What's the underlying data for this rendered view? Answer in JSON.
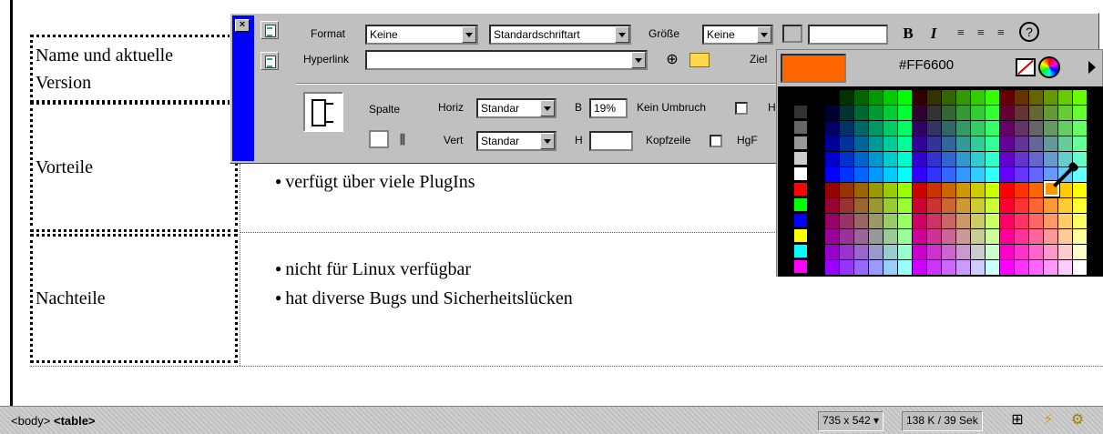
{
  "document": {
    "cells": [
      {
        "label_line1": "Name und aktuelle",
        "label_line2": "Version"
      },
      {
        "label": "Vorteile"
      },
      {
        "label": "Nachteile"
      }
    ],
    "bullets_vorteile": [
      "verfügt über viele PlugIns"
    ],
    "bullets_nachteile": [
      "nicht für Linux verfügbar",
      "hat diverse Bugs und Sicherheitslücken"
    ]
  },
  "inspector": {
    "close_label": "×",
    "format_label": "Format",
    "format_value": "Keine",
    "font_value": "Standardschriftart",
    "size_label": "Größe",
    "size_value": "Keine",
    "bold_label": "B",
    "italic_label": "I",
    "help_label": "?",
    "hyperlink_label": "Hyperlink",
    "hyperlink_value": "",
    "target_label": "Ziel",
    "column_label": "Spalte",
    "horiz_label": "Horiz",
    "horiz_value": "Standar",
    "vert_label": "Vert",
    "vert_value": "Standar",
    "width_label": "B",
    "width_value": "19%",
    "height_label": "H",
    "height_value": "",
    "nowrap_label": "Kein Umbruch",
    "header_label": "Kopfzeile",
    "bg_label": "HgF",
    "h_cut_label": "H"
  },
  "color_picker": {
    "current_hex": "#FF6600",
    "current_color": "#ff6600",
    "no_color_icon": "no-color-icon",
    "system_picker_icon": "color-wheel-icon",
    "expand_icon": "triangle-right-icon"
  },
  "statusbar": {
    "tag_body": "<body>",
    "tag_table": "<table>",
    "window_size": "735 x 542",
    "download": "138 K / 39 Sek"
  }
}
